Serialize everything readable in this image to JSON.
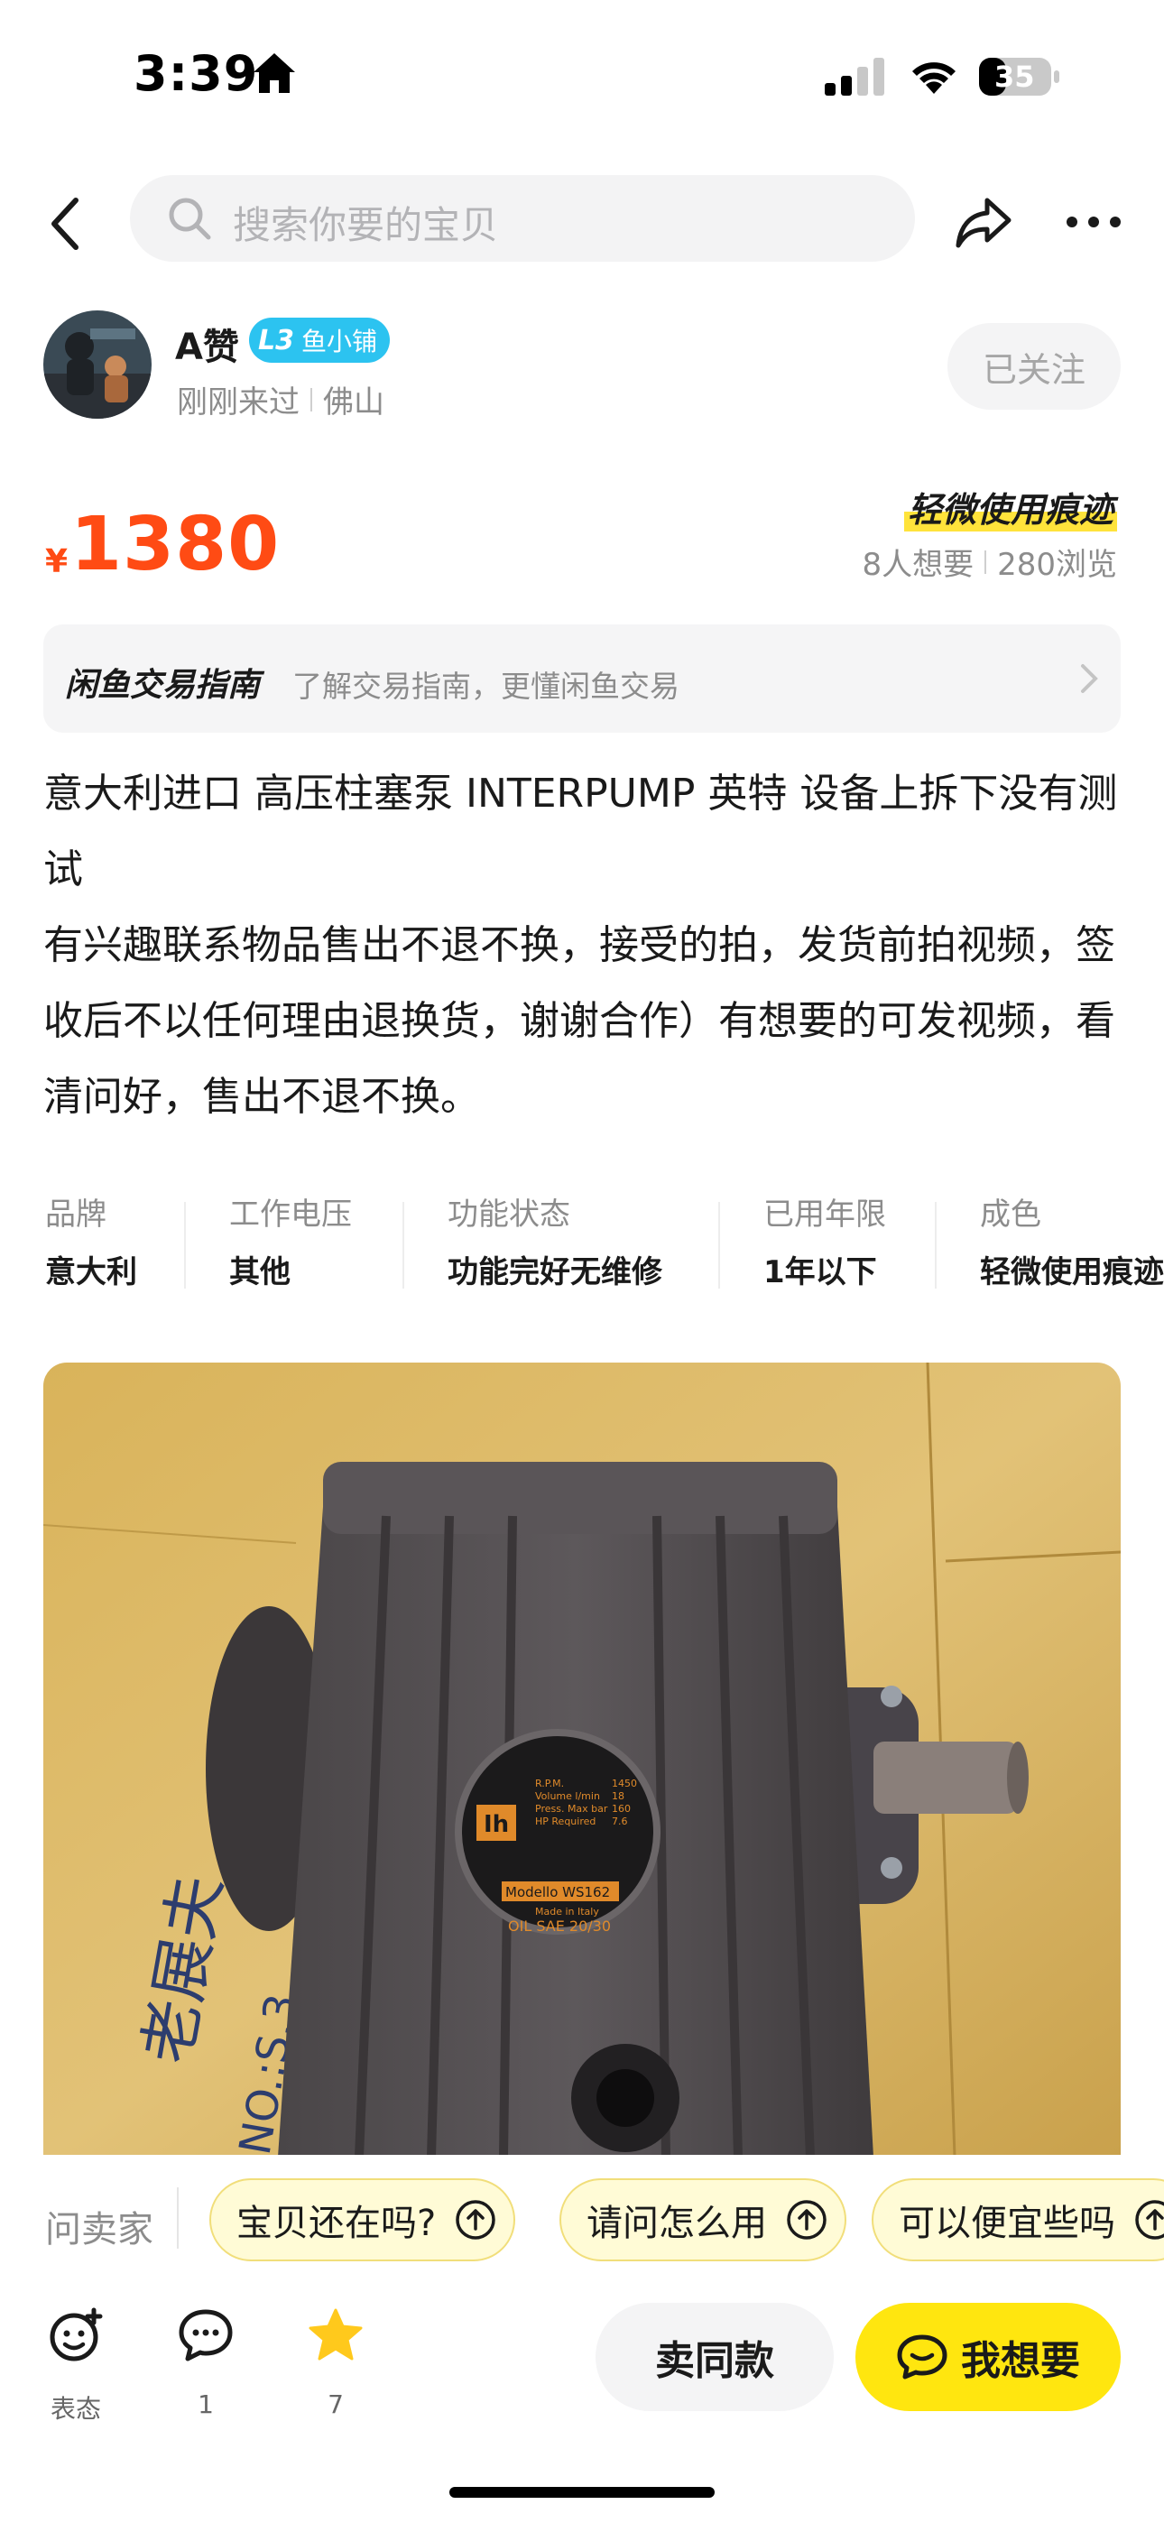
{
  "status_bar": {
    "time": "3:39",
    "battery": "35"
  },
  "nav": {
    "search_placeholder": "搜索你要的宝贝"
  },
  "seller": {
    "name": "A赞",
    "level": "L3",
    "badge": "鱼小铺",
    "last_seen": "刚刚来过",
    "location": "佛山",
    "follow_label": "已关注"
  },
  "price": {
    "currency": "¥",
    "value": "1380",
    "condition": "轻微使用痕迹",
    "wants": "8人想要",
    "views": "280浏览",
    "color": "#ff4b14"
  },
  "guide": {
    "title": "闲鱼交易指南",
    "text": "了解交易指南，更懂闲鱼交易"
  },
  "description": [
    "意大利进口 高压柱塞泵  INTERPUMP 英特 设备上拆下没有测试",
    "有兴趣联系物品售出不退不换，接受的拍，发货前拍视频，签收后不以任何理由退换货，谢谢合作）有想要的可发视频，看清问好，售出不退不换。"
  ],
  "attributes": [
    {
      "label": "品牌",
      "value": "意大利"
    },
    {
      "label": "工作电压",
      "value": "其他"
    },
    {
      "label": "功能状态",
      "value": "功能完好无维修"
    },
    {
      "label": "已用年限",
      "value": "1年以下"
    },
    {
      "label": "成色",
      "value": "轻微使用痕迹"
    }
  ],
  "photo": {
    "plate_lines": [
      "R.P.M.",
      "Volume l/min",
      "Press. Max bar",
      "HP Required"
    ],
    "plate_values": [
      "1450",
      "18",
      "160",
      "7.6"
    ],
    "model": "Modello WS162",
    "made": "Made in Italy",
    "oil": "OIL SAE 20/30",
    "side_text": "老展夫",
    "side_code": "NO.:S.3"
  },
  "questions": {
    "label": "问卖家",
    "chips": [
      "宝贝还在吗?",
      "请问怎么用",
      "可以便宜些吗"
    ]
  },
  "actions": {
    "react_label": "表态",
    "comment_count": "1",
    "star_count": "7",
    "same_label": "卖同款",
    "want_label": "我想要",
    "accent": "#ffe60f"
  }
}
